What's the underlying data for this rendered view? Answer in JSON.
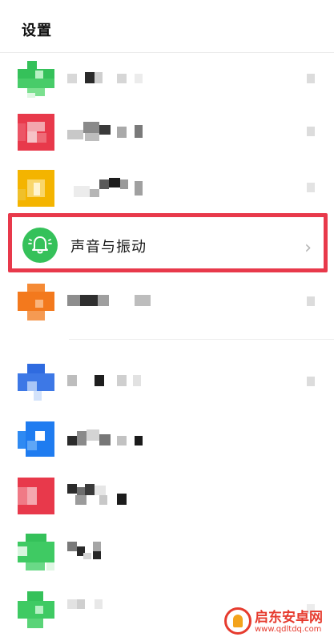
{
  "header": {
    "title": "设置"
  },
  "highlighted_item": {
    "label": "声音与振动",
    "icon": "bell-icon",
    "chevron": "›"
  },
  "watermark": {
    "title": "启东安卓网",
    "url": "www.qdltdq.com"
  },
  "colors": {
    "green": "#35c15a",
    "red": "#e8394b",
    "yellow": "#f4b400",
    "orange": "#f3791d",
    "blue": "#2f6be0",
    "highlight_border": "#e8394b"
  },
  "rows": [
    {
      "name": "settings-row-1",
      "icon_color": "green",
      "label": ""
    },
    {
      "name": "settings-row-2",
      "icon_color": "red",
      "label": ""
    },
    {
      "name": "settings-row-3",
      "icon_color": "yellow",
      "label": ""
    },
    {
      "name": "settings-row-5",
      "icon_color": "orange",
      "label": ""
    },
    {
      "name": "settings-row-6",
      "icon_color": "blue",
      "label": ""
    },
    {
      "name": "settings-row-7",
      "icon_color": "blue",
      "label": ""
    },
    {
      "name": "settings-row-8",
      "icon_color": "red",
      "label": ""
    },
    {
      "name": "settings-row-9",
      "icon_color": "green",
      "label": ""
    },
    {
      "name": "settings-row-10",
      "icon_color": "green",
      "label": ""
    }
  ]
}
